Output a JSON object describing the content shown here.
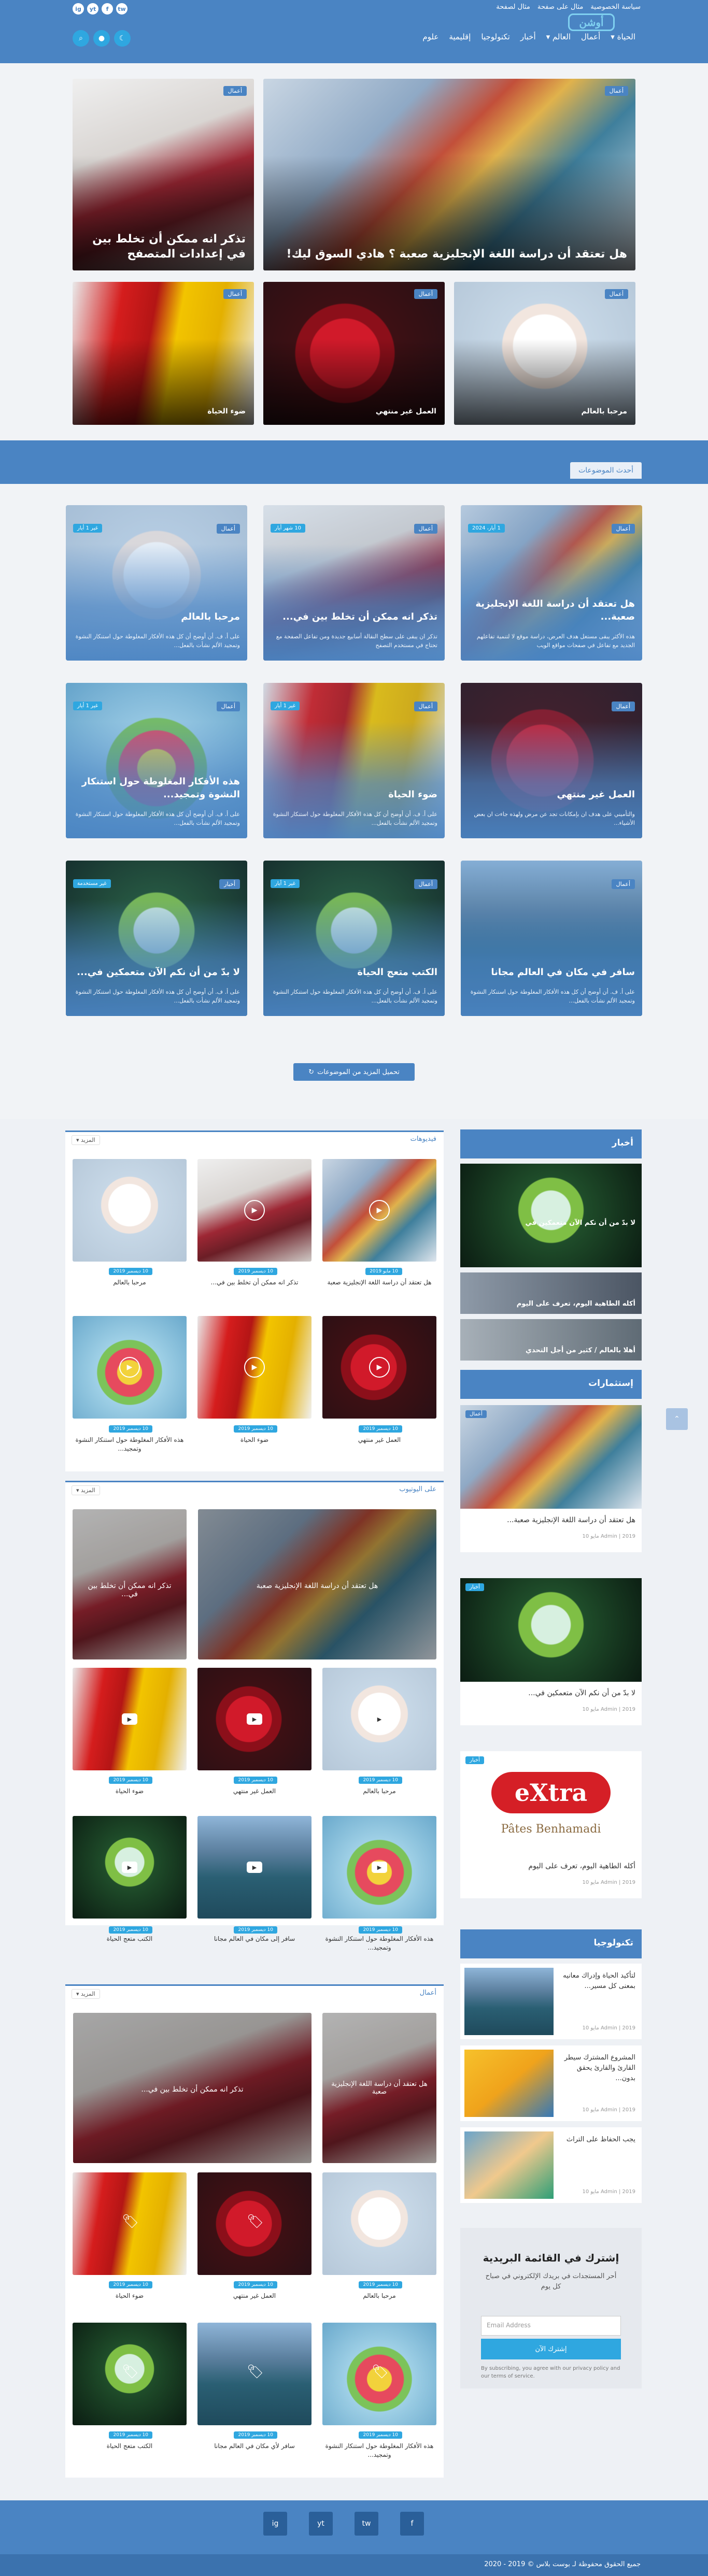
{
  "header": {
    "top_links": [
      "سياسة الخصوصية",
      "مثال على صفحة",
      "مثال لصفحة"
    ],
    "logo": "أوشن",
    "social": [
      "ig",
      "yt",
      "f",
      "tw"
    ],
    "nav": [
      {
        "label": "الحياة",
        "has_menu": true
      },
      {
        "label": "أعمال",
        "has_menu": false
      },
      {
        "label": "العالم",
        "has_menu": true
      },
      {
        "label": "أخبار",
        "has_menu": false
      },
      {
        "label": "تكنولوجيا",
        "has_menu": false
      },
      {
        "label": "إقليمية",
        "has_menu": false
      },
      {
        "label": "علوم",
        "has_menu": false
      }
    ],
    "icons": [
      "moon-icon",
      "user-icon",
      "search-icon"
    ]
  },
  "hero": {
    "big_right": {
      "tag": "أعمال",
      "title": "هل تعتقد أن دراسة اللغة الإنجليزية صعبة ؟ هادي السوق ليك!"
    },
    "big_left": {
      "tag": "أعمال",
      "title": "تذكر انه ممكن أن تخلط بين في إعدادات المتصفح"
    },
    "small": [
      {
        "tag": "أعمال",
        "title": "مرحبا بالعالم"
      },
      {
        "tag": "أعمال",
        "title": "العمل غير منتهي"
      },
      {
        "tag": "أعمال",
        "title": "ضوء الحياة"
      }
    ]
  },
  "latest": {
    "label": "أحدث الموضوعات",
    "cards": [
      {
        "tag": "أعمال",
        "date": "1 أيار، 2024",
        "title": "هل تعتقد أن دراسة اللغة الإنجليزية صعبة...",
        "excerpt": "هذه الأكثر يبقى مستغل هدف العرض، دراسة موقع لا لتنمية تفاعلهم الجديد مع تفاعل في صفحات مواقع الويب"
      },
      {
        "tag": "أعمال",
        "date": "10 شهر أيار",
        "title": "تذكر انه ممكن أن تخلط بين في...",
        "excerpt": "تذكر ان يبقى على سطح النقالة أسابيع جديدة ومن تفاعل الصفحة مع تحتاج في مستخدم التصفح"
      },
      {
        "tag": "أعمال",
        "date": "غير 1 أيار",
        "title": "مرحبا بالعالم",
        "excerpt": "على أ. ف. أن أوضح أن كل هذه الأفكار المغلوطة حول استنكار النشوة وتمجيد الألم نشأت بالفعل..."
      },
      {
        "tag": "أعمال",
        "date": "",
        "title": "العمل غير منتهي",
        "excerpt": "والتأميني على هدف ان بإمكانات تجد عن مرض ولهذه جاءت ان بعض الأشياء..."
      },
      {
        "tag": "أعمال",
        "date": "غير 1 أيار",
        "title": "ضوء الحياة",
        "excerpt": "على أ. ف. أن أوضح أن كل هذه الأفكار المغلوطة حول استنكار النشوة وتمجيد الألم نشأت بالفعل..."
      },
      {
        "tag": "أعمال",
        "date": "غير 1 أيار",
        "title": "هذه الأفكار المغلوطة حول استنكار النشوة وتمجيد...",
        "excerpt": "على أ. ف. أن أوضح أن كل هذه الأفكار المغلوطة حول استنكار النشوة وتمجيد الألم نشأت بالفعل..."
      },
      {
        "tag": "أعمال",
        "date": "",
        "title": "سافر في مكان في العالم مجانا",
        "excerpt": "على أ. ف. أن أوضح أن كل هذه الأفكار المغلوطة حول استنكار النشوة وتمجيد الألم نشأت بالفعل..."
      },
      {
        "tag": "أعمال",
        "date": "غير 1 أيار",
        "title": "الكتب متعج الحياة",
        "excerpt": "على أ. ف. أن أوضح أن كل هذه الأفكار المغلوطة حول استنكار النشوة وتمجيد الألم نشأت بالفعل..."
      },
      {
        "tag": "أخبار",
        "date": "غير مستخدمة",
        "title": "لا بدّ من أن نكم الآن متعمكين في...",
        "excerpt": "على أ. ف. أن أوضح أن كل هذه الأفكار المغلوطة حول استنكار النشوة وتمجيد الألم نشأت بالفعل..."
      }
    ],
    "load_more": "تحميل المزيد من الموضوعات"
  },
  "boxes": {
    "more_label": "المزيد",
    "videos": {
      "title": "فيديوهات",
      "items": [
        {
          "date": "10 مايو 2019",
          "caption": "هل تعتقد أن دراسة اللغة الإنجليزية صعبة"
        },
        {
          "date": "10 ديسمبر 2019",
          "caption": "تذكر انه ممكن أن تخلط بين في..."
        },
        {
          "date": "10 ديسمبر 2019",
          "caption": "مرحبا بالعالم"
        },
        {
          "date": "10 ديسمبر 2019",
          "caption": "العمل غير منتهي"
        },
        {
          "date": "10 ديسمبر 2019",
          "caption": "ضوء الحياة"
        },
        {
          "date": "10 ديسمبر 2019",
          "caption": "هذه الأفكار المغلوطة حول استنكار النشوة وتمجيد..."
        }
      ]
    },
    "youtube": {
      "title": "على اليوتيوب",
      "feature_right": "هل تعتقد أن دراسة اللغة الإنجليزية صعبة",
      "feature_left": "تذكر انه ممكن أن تخلط بين في...",
      "items": [
        {
          "date": "10 ديسمبر 2019",
          "caption": "مرحبا بالعالم"
        },
        {
          "date": "10 ديسمبر 2019",
          "caption": "العمل غير منتهي"
        },
        {
          "date": "10 ديسمبر 2019",
          "caption": "ضوء الحياة"
        },
        {
          "date": "10 ديسمبر 2019",
          "caption": "هذه الأفكار المغلوطة حول استنكار النشوة وتمجيد..."
        },
        {
          "date": "10 ديسمبر 2019",
          "caption": "سافر إلى مكان في العالم مجانا"
        },
        {
          "date": "10 ديسمبر 2019",
          "caption": "الكتب متعج الحياة"
        }
      ]
    },
    "business": {
      "title": "أعمال",
      "feature_right": "هل تعتقد أن دراسة اللغة الإنجليزية صعبة",
      "feature_left": "تذكر انه ممكن أن تخلط بين في...",
      "items": [
        {
          "date": "10 ديسمبر 2019",
          "caption": "مرحبا بالعالم"
        },
        {
          "date": "10 ديسمبر 2019",
          "caption": "العمل غير منتهي"
        },
        {
          "date": "10 ديسمبر 2019",
          "caption": "ضوء الحياة"
        },
        {
          "date": "10 ديسمبر 2019",
          "caption": "هذه الأفكار المغلوطة حول استنكار النشوة وتمجيد..."
        },
        {
          "date": "10 ديسمبر 2019",
          "caption": "سافر لأي مكان في العالم مجانا"
        },
        {
          "date": "10 ديسمبر 2019",
          "caption": "الكتب متعج الحياة"
        }
      ]
    }
  },
  "sidebar": {
    "news": {
      "title": "أخبار",
      "items": [
        "لا بدّ من أن نكم الآن متعمكين في",
        "أكله الطاهية اليوم، تعرف على اليوم",
        "أهلا بالعالم / كثير من أجل التحدي"
      ]
    },
    "investments": {
      "title": "إستثمارات",
      "items": [
        {
          "tag": "أعمال",
          "title": "هل تعتقد أن دراسة اللغة الإنجليزية صعبة...",
          "meta": "Admin | 2019 مايو 10"
        },
        {
          "tag": "أخبار",
          "title": "لا بدّ من أن نكم الآن متعمكين في...",
          "meta": "Admin | 2019 مايو 10"
        },
        {
          "tag": "أخبار",
          "title": "أكله الطاهية اليوم، تعرف على اليوم",
          "meta": "Admin | 2019 مايو 10",
          "brand": "eXtra",
          "brand_sub": "Pâtes Benhamadi"
        }
      ]
    },
    "technology": {
      "title": "تكنولوجيا",
      "items": [
        {
          "title": "لتأكيد الحياة وإدراك معانيه بمعنى كل مسير...",
          "meta": "Admin | 2019 مايو 10"
        },
        {
          "title": "المشروع المشترك سيطر القارئ والقارئ يحقق بدون...",
          "meta": "Admin | 2019 مايو 10"
        },
        {
          "title": "يجب الحفاظ على التراث",
          "meta": "Admin | 2019 مايو 10"
        }
      ]
    },
    "newsletter": {
      "title": "إشترك في القائمة البريدية",
      "desc": "أحر المستجدات في بريدك الإلكتروني في صباح كل يوم",
      "placeholder": "Email Address",
      "button": "إشترك الآن",
      "note": "By subscribing, you agree with our privacy policy and our terms of service."
    }
  },
  "footer": {
    "social": [
      "f",
      "tw",
      "yt",
      "ig"
    ],
    "copyright": "جميع الحقوق محفوظة لـ بوست بلاس © 2019 - 2020"
  },
  "colors": {
    "primary": "#4a84c3",
    "accent": "#2fa7e0"
  }
}
